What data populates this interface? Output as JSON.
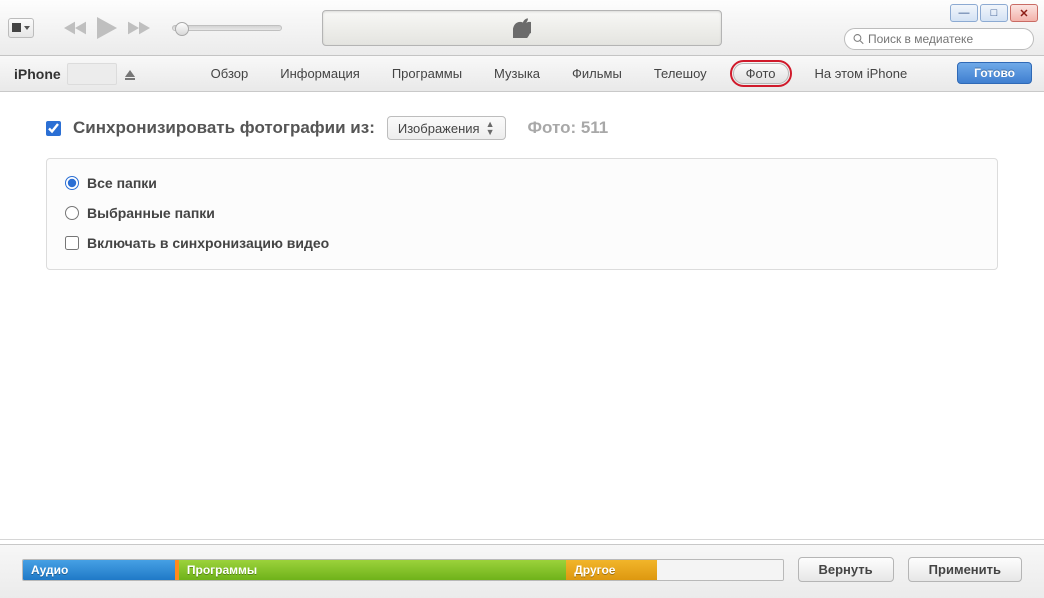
{
  "search": {
    "placeholder": "Поиск в медиатеке"
  },
  "device": {
    "name": "iPhone"
  },
  "tabs": {
    "overview": "Обзор",
    "info": "Информация",
    "apps": "Программы",
    "music": "Музыка",
    "movies": "Фильмы",
    "tvshows": "Телешоу",
    "photos": "Фото",
    "on_device": "На этом iPhone"
  },
  "done_label": "Готово",
  "sync": {
    "label": "Синхронизировать фотографии из:",
    "source": "Изображения",
    "count_label": "Фото: 511"
  },
  "options": {
    "all_folders": "Все папки",
    "selected_folders": "Выбранные папки",
    "include_videos": "Включать в синхронизацию видео"
  },
  "capacity": {
    "audio": "Аудио",
    "apps": "Программы",
    "other": "Другое"
  },
  "footer": {
    "revert": "Вернуть",
    "apply": "Применить"
  },
  "volume_pct": 4
}
